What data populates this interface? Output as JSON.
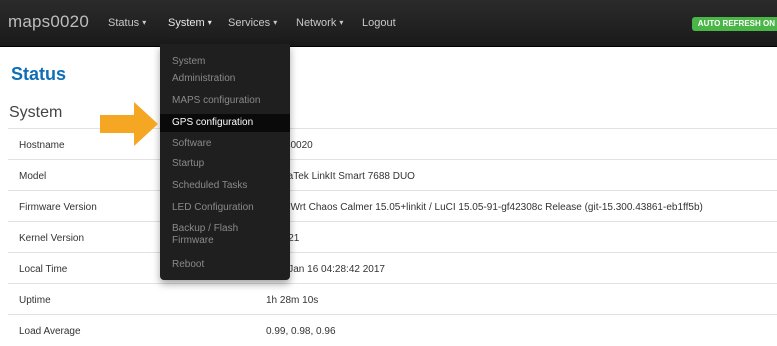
{
  "navbar": {
    "brand": "maps0020",
    "menu": [
      {
        "label": "Status",
        "caret": "▾"
      },
      {
        "label": "System",
        "caret": "▾"
      },
      {
        "label": "Services",
        "caret": "▾"
      },
      {
        "label": "Network",
        "caret": "▾"
      },
      {
        "label": "Logout",
        "caret": ""
      }
    ],
    "autorefresh": "AUTO REFRESH ON"
  },
  "page": {
    "title": "Status",
    "section": "System"
  },
  "rows": [
    {
      "label": "Hostname",
      "value": "maps0020"
    },
    {
      "label": "Model",
      "value": "MediaTek LinkIt Smart 7688 DUO"
    },
    {
      "label": "Firmware Version",
      "value": "OpenWrt Chaos Calmer 15.05+linkit / LuCI 15.05-91-gf42308c Release (git-15.300.43861-eb1ff5b)"
    },
    {
      "label": "Kernel Version",
      "value": "3.18.21"
    },
    {
      "label": "Local Time",
      "value": "Mon Jan 16 04:28:42 2017"
    },
    {
      "label": "Uptime",
      "value": "1h 28m 10s"
    },
    {
      "label": "Load Average",
      "value": "0.99, 0.98, 0.96"
    }
  ],
  "system_menu": [
    "System",
    "Administration",
    "MAPS configuration",
    "GPS configuration",
    "Software",
    "Startup",
    "Scheduled Tasks",
    "LED Configuration",
    "Backup / Flash\nFirmware",
    "Reboot"
  ],
  "colors": {
    "navbar": "#222222",
    "title": "#0f6fb6",
    "autorefresh": "#4bb648",
    "arrow": "#f5a623"
  }
}
